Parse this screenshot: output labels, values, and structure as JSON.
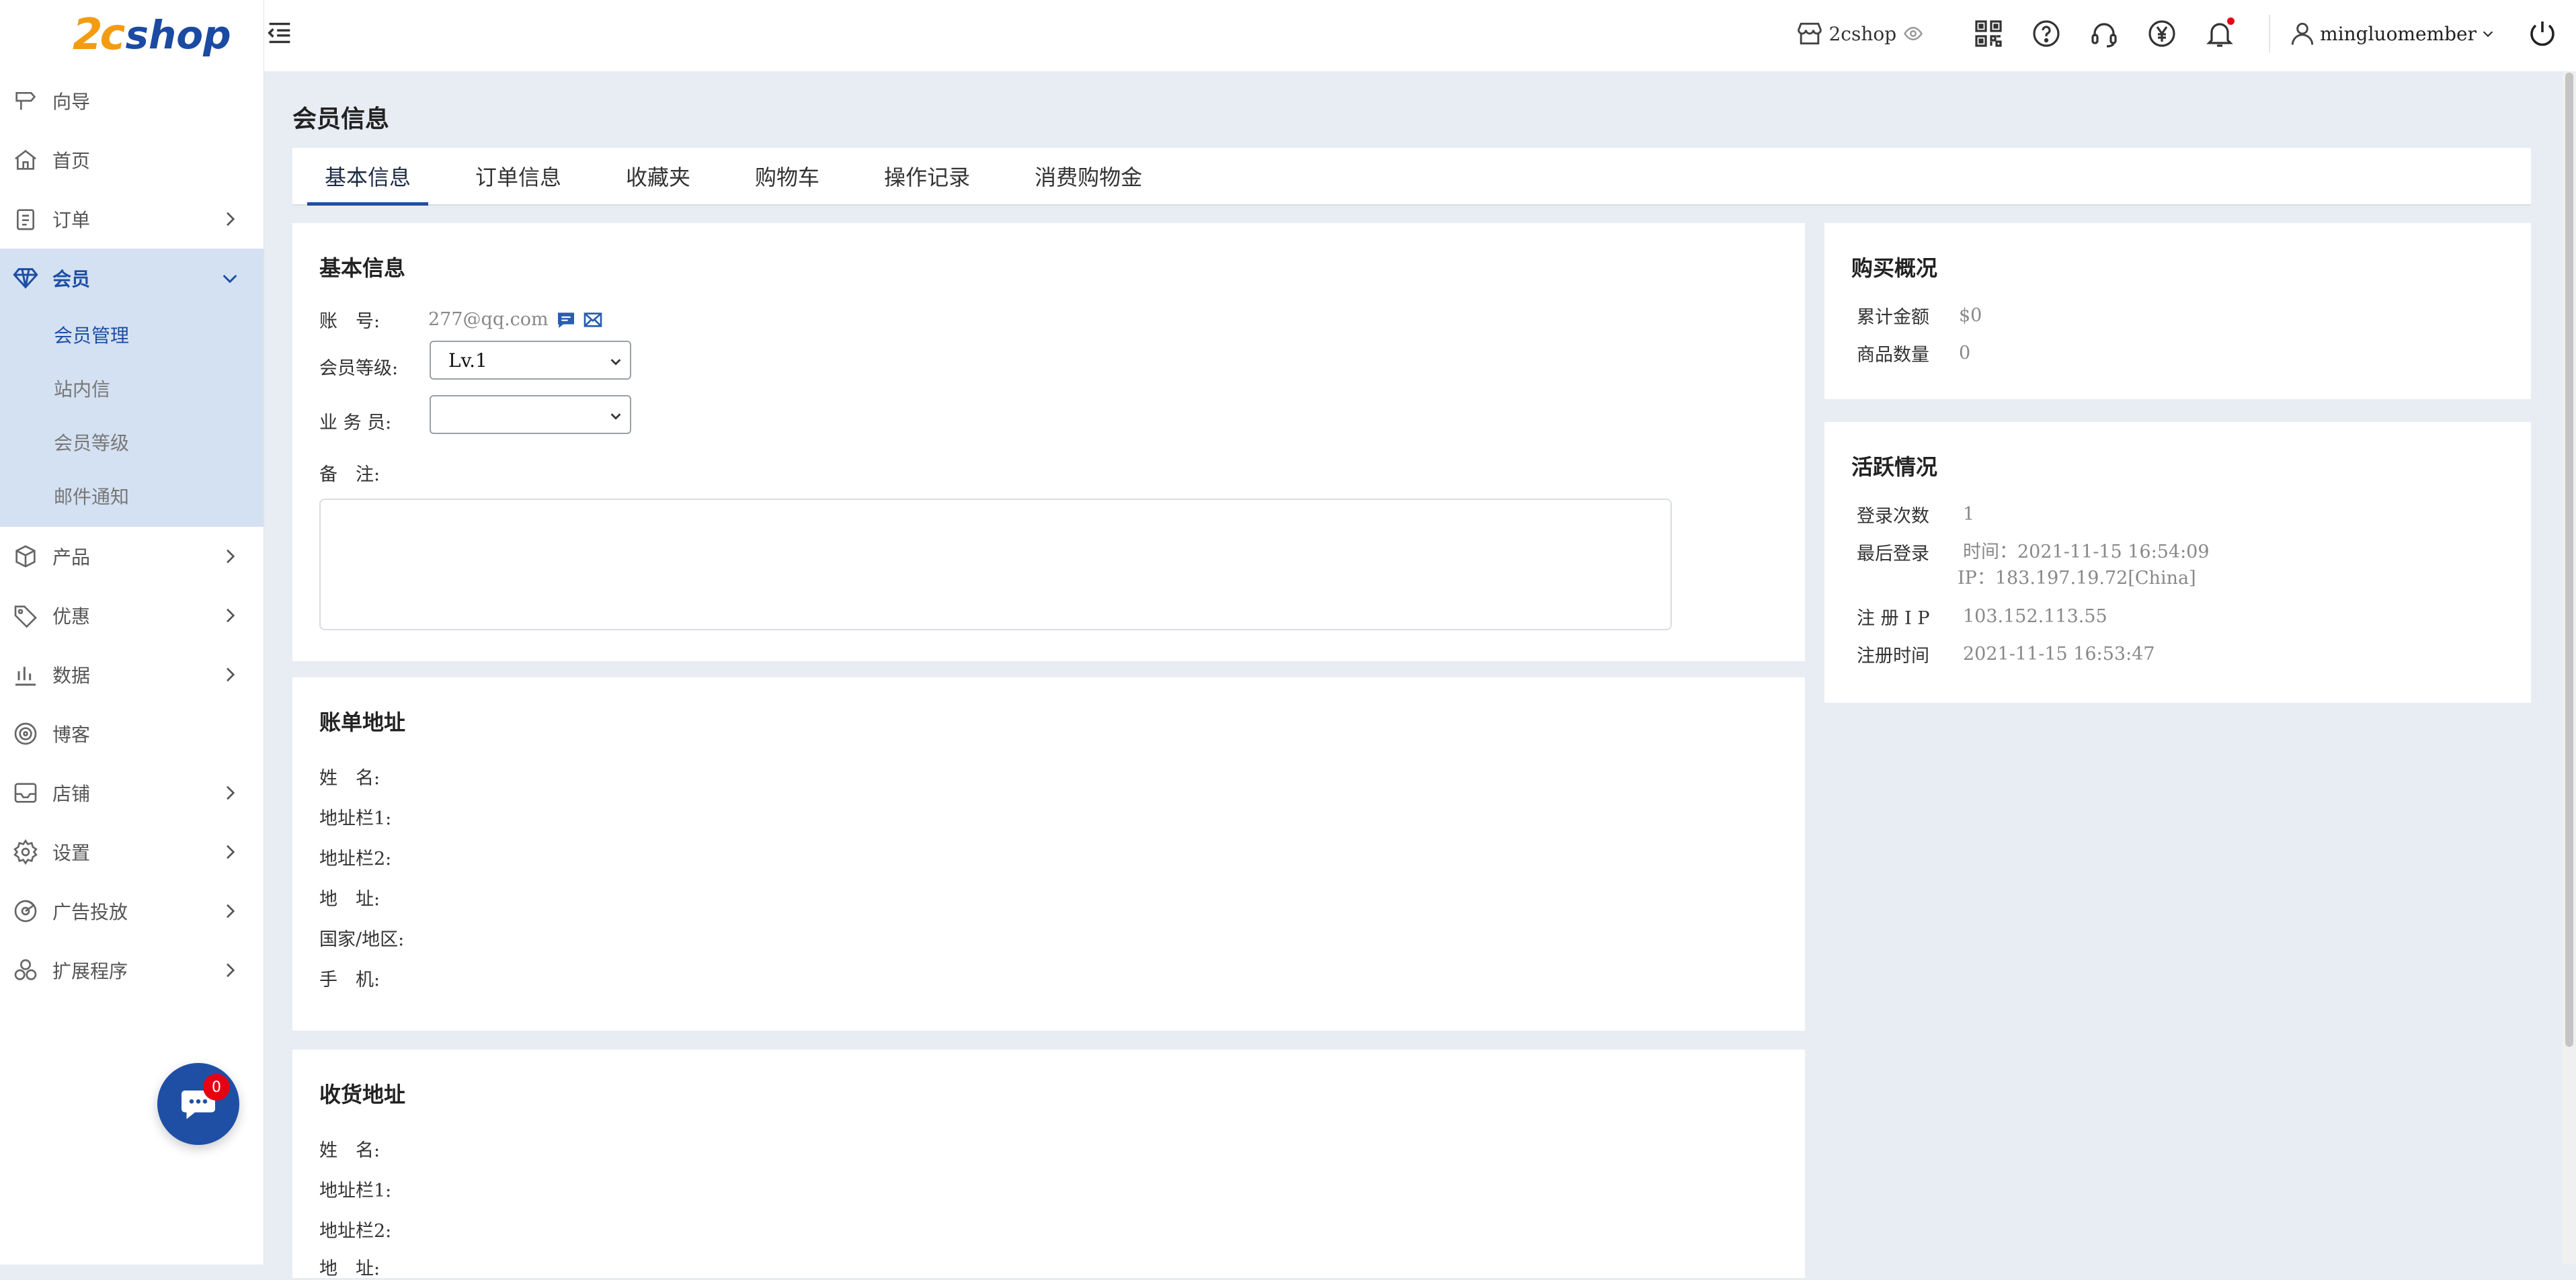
{
  "app": {
    "logo_mark": "2c",
    "logo_text": "shop"
  },
  "sidebar": {
    "items": [
      {
        "label": "向导",
        "icon": "signpost-icon"
      },
      {
        "label": "首页",
        "icon": "home-icon"
      },
      {
        "label": "订单",
        "icon": "clipboard-icon"
      },
      {
        "label": "会员",
        "icon": "diamond-icon"
      },
      {
        "label": "产品",
        "icon": "box-icon"
      },
      {
        "label": "优惠",
        "icon": "tag-icon"
      },
      {
        "label": "数据",
        "icon": "bar-chart-icon"
      },
      {
        "label": "博客",
        "icon": "target-icon"
      },
      {
        "label": "店铺",
        "icon": "store-icon"
      },
      {
        "label": "设置",
        "icon": "gear-icon"
      },
      {
        "label": "广告投放",
        "icon": "ads-icon"
      },
      {
        "label": "扩展程序",
        "icon": "extensions-icon"
      }
    ],
    "member_submenu": [
      "会员管理",
      "站内信",
      "会员等级",
      "邮件通知"
    ],
    "chat_badge": "0"
  },
  "topbar": {
    "shop_name": "2cshop",
    "username": "mingluomember"
  },
  "page": {
    "title": "会员信息",
    "tabs": [
      "基本信息",
      "订单信息",
      "收藏夹",
      "购物车",
      "操作记录",
      "消费购物金"
    ]
  },
  "basic_info": {
    "title": "基本信息",
    "account_label": "账　号:",
    "account_value": "277@qq.com",
    "level_label": "会员等级:",
    "level_value": "Lv.1",
    "salesman_label": "业 务 员:",
    "salesman_value": "",
    "remark_label": "备　注:"
  },
  "billing": {
    "title": "账单地址",
    "labels": [
      "姓　名:",
      "地址栏1:",
      "地址栏2:",
      "地　址:",
      "国家/地区:",
      "手　机:"
    ]
  },
  "shipping": {
    "title": "收货地址",
    "labels": [
      "姓　名:",
      "地址栏1:",
      "地址栏2:",
      "地　址:"
    ]
  },
  "purchase": {
    "title": "购买概况",
    "total_label": "累计金额",
    "total_value": "$0",
    "count_label": "商品数量",
    "count_value": "0"
  },
  "activity": {
    "title": "活跃情况",
    "login_count_label": "登录次数",
    "login_count_value": "1",
    "last_login_label": "最后登录",
    "last_login_time": "时间：2021-11-15 16:54:09",
    "last_login_ip": "IP：183.197.19.72[China]",
    "reg_ip_label": "注 册 I P",
    "reg_ip_value": "103.152.113.55",
    "reg_time_label": "注册时间",
    "reg_time_value": "2021-11-15 16:53:47"
  },
  "colors": {
    "brand_blue": "#1f4fa5",
    "brand_orange": "#f39c12",
    "active_bg": "#d4e1f2",
    "badge_red": "#e60012"
  }
}
